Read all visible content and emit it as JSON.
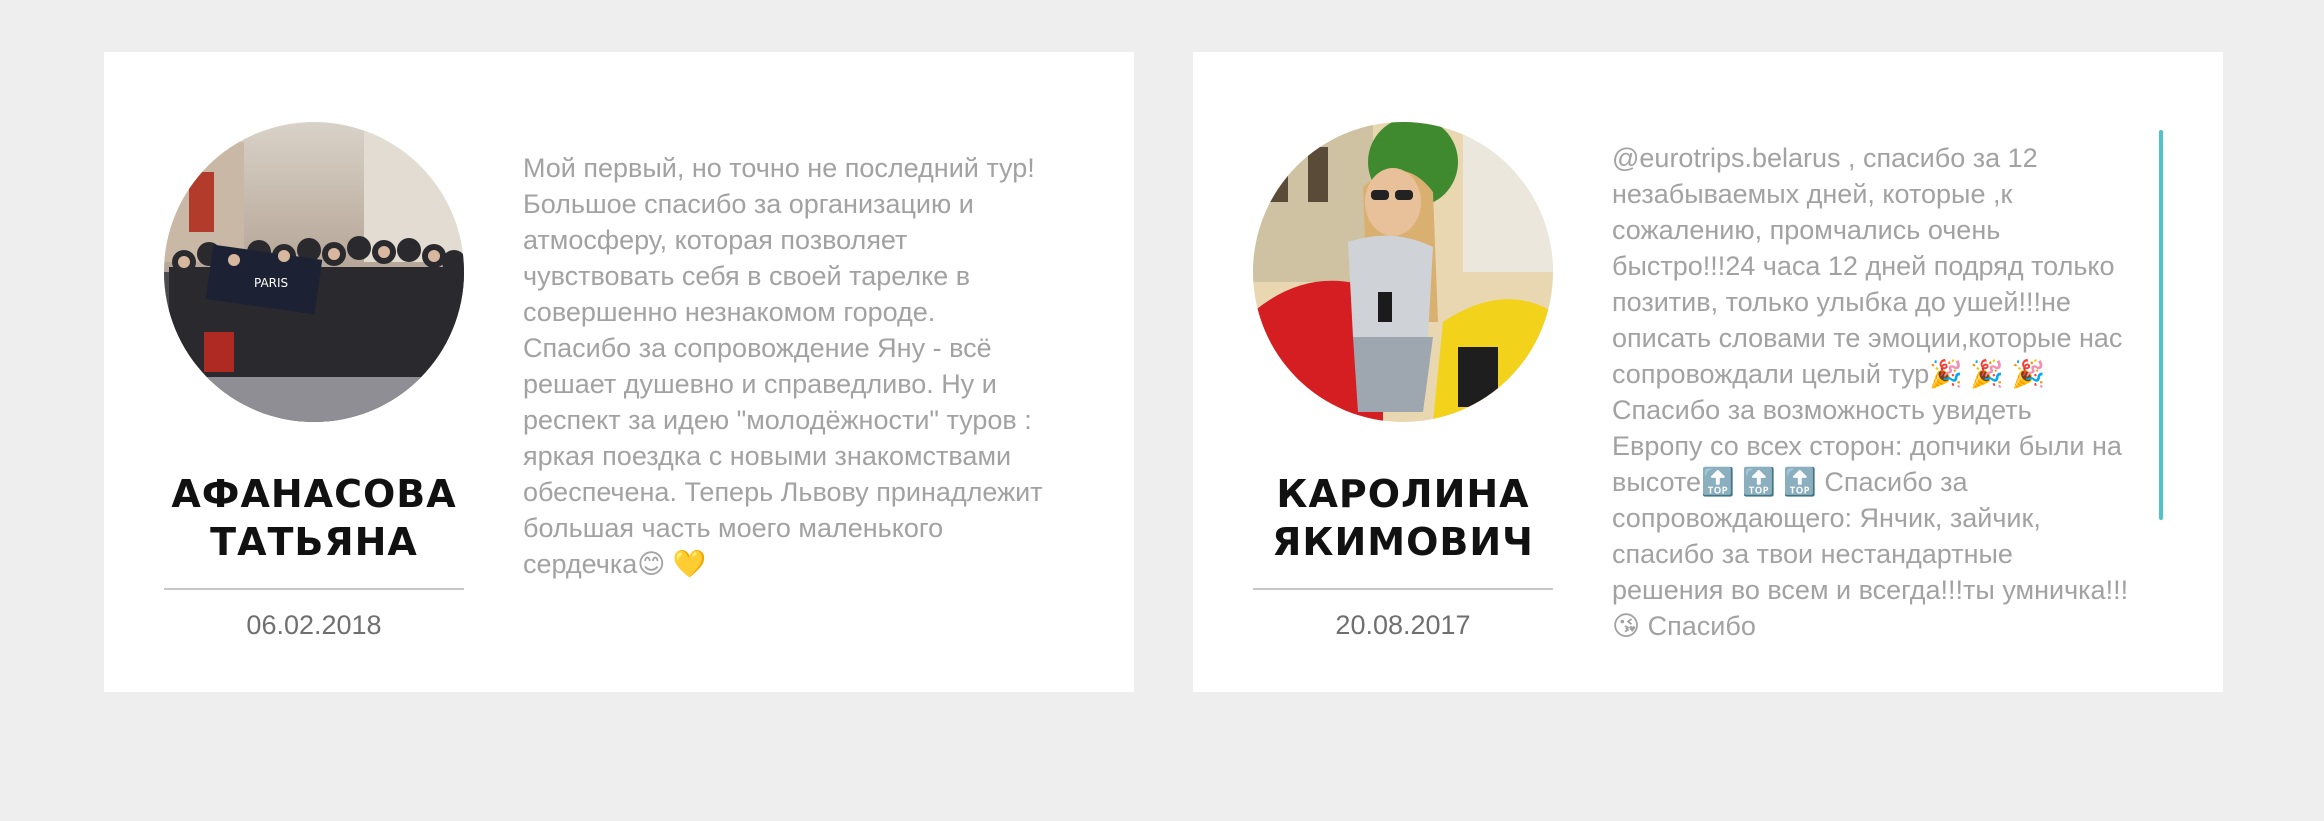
{
  "reviews": [
    {
      "name": "АФАНАСОВА ТАТЬЯНА",
      "date": "06.02.2018",
      "text": "Мой первый, но точно не последний тур!\nБольшое спасибо за организацию и\nатмосферу, которая позволяет\nчувствовать себя в своей тарелке в\nсовершенно незнакомом городе.\nСпасибо за сопровождение Яну - всё\nрешает душевно и справедливо. Ну и\nреспект за идею \"молодёжности\" туров :\nяркая поездка с новыми знакомствами\nобеспечена. Теперь Львову принадлежит\nбольшая часть моего маленького\nсердечка😊 💛"
    },
    {
      "name": "КАРОЛИНА ЯКИМОВИЧ",
      "date": "20.08.2017",
      "text": "@eurotrips.belarus , спасибо за 12\nнезабываемых дней, которые ,к\nсожалению, промчались очень\nбыстро!!!24 часа 12 дней подряд только\nпозитив, только улыбка до ушей!!!не\nописать словами те эмоции,которые нас\nсопровождали целый тур🎉 🎉 🎉\nСпасибо за возможность увидеть\nЕвропу со всех сторон: допчики были на\nвысоте🔝 🔝 🔝  Спасибо за\nсопровождающего: Янчик, зайчик,\nспасибо за твои нестандартные\nрешения во всем и всегда!!!ты умничка!!!\n                                😘 Спасибо"
    }
  ]
}
